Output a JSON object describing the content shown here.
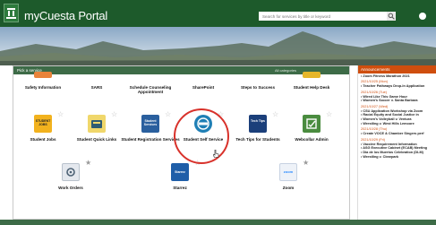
{
  "header": {
    "title": "myCuesta Portal",
    "search_placeholder": "Search for services by title or keyword",
    "search_icon": "magnifier",
    "user_icon": "user-avatar"
  },
  "colors": {
    "header_green": "#1d5a2b",
    "section_green": "#3d6b47",
    "announce_orange": "#cf4e0e",
    "highlight_red": "#d8322b"
  },
  "services": {
    "heading": "Pick a service",
    "count_label": "All categories",
    "tiles": [
      {
        "label": "Safety Information",
        "icon": "safety-icon"
      },
      {
        "label": "SARS",
        "icon": "sars-icon"
      },
      {
        "label": "Schedule Counseling Appointment",
        "icon": "calendar-icon"
      },
      {
        "label": "SharePoint",
        "icon": "sharepoint-icon"
      },
      {
        "label": "Steps to Success",
        "icon": "steps-icon"
      },
      {
        "label": "Student Help Desk",
        "icon": "helpdesk-icon"
      },
      {
        "label": "Student Jobs",
        "icon": "student-jobs-icon",
        "icon_text": "STUDENT JOBS"
      },
      {
        "label": "Student Quick Links",
        "icon": "quick-links-icon"
      },
      {
        "label": "Student Registration Services",
        "icon": "registration-icon",
        "icon_text": "Student Services"
      },
      {
        "label": "Student Self Service",
        "icon": "self-service-icon"
      },
      {
        "label": "Tech Tips for Students",
        "icon": "tech-tips-icon",
        "icon_text": "Tech Tips"
      },
      {
        "label": "Webcollar Admin",
        "icon": "webcollar-icon"
      },
      {
        "label": "Work Orders",
        "icon": "work-orders-icon"
      },
      {
        "label": "Starrez",
        "icon": "starrez-icon",
        "icon_text": "Starrez"
      },
      {
        "label": "Zoom",
        "icon": "zoom-icon",
        "icon_text": "zoom"
      }
    ]
  },
  "announcements": {
    "heading": "Announcements",
    "entries": [
      {
        "date": "",
        "item": "• Zoom Fitness Marathon 2021"
      },
      {
        "date": "2021/10/25 (Mon)",
        "item": "• Teacher Pathways Drop-In Application"
      },
      {
        "date": "2021/10/26 (Tue)",
        "item": "• Wired Like This Game Hour"
      },
      {
        "date": "",
        "item": "• Women's Soccer v. Santa Barbara"
      },
      {
        "date": "2021/10/27 (Wed)",
        "item": "• CSU Application Workshop via Zoom"
      },
      {
        "date": "",
        "item": "• Racial Equity and Social Justice in"
      },
      {
        "date": "",
        "item": "• Women's Volleyball v. Ventura"
      },
      {
        "date": "",
        "item": "• Wrestling v. West Hills Lemoore"
      },
      {
        "date": "2021/10/28 (Thu)",
        "item": "• Create VOCE & Chamber Singers perf"
      },
      {
        "date": "2021/10/29 (Fri)",
        "item": "• Vaccine Requirement Information"
      },
      {
        "date": "",
        "item": "• ASG Executive Cabinet (ECAB) Meeting"
      },
      {
        "date": "",
        "item": "• Dia de los Muertos Celebration (DLM)"
      },
      {
        "date": "",
        "item": "• Wrestling v. Clearpark"
      }
    ]
  }
}
